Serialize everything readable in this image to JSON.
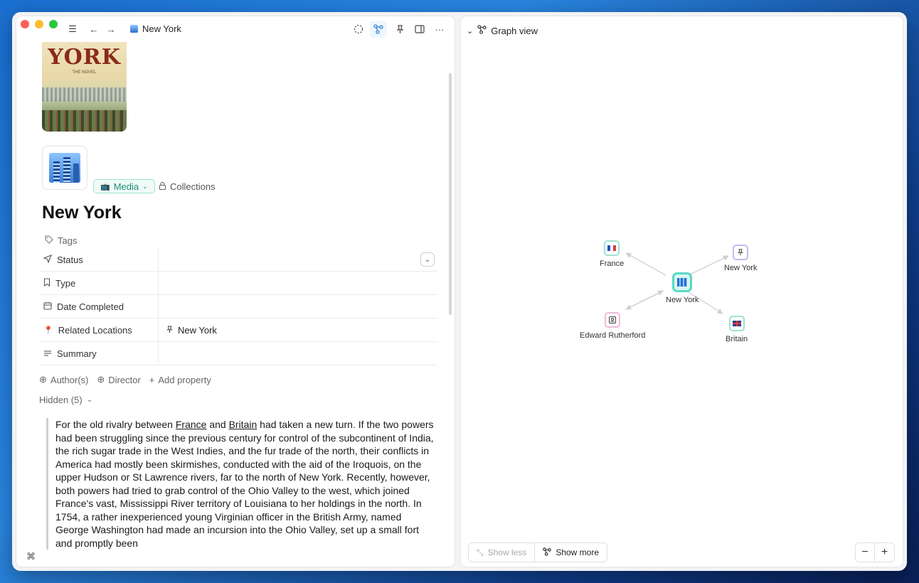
{
  "toolbar": {
    "breadcrumb": "New York"
  },
  "page": {
    "cover_title": "YORK",
    "cover_subtitle": "THE NOVEL",
    "media_label": "Media",
    "collections_label": "Collections",
    "title": "New York",
    "tags_label": "Tags"
  },
  "properties": [
    {
      "label": "Status",
      "value": ""
    },
    {
      "label": "Type",
      "value": ""
    },
    {
      "label": "Date Completed",
      "value": ""
    },
    {
      "label": "Related Locations",
      "value": "New York"
    },
    {
      "label": "Summary",
      "value": ""
    }
  ],
  "add_props": {
    "authors": "Author(s)",
    "director": "Director",
    "add": "Add property"
  },
  "hidden_label": "Hidden (5)",
  "quote": {
    "p1": "For the old rivalry between ",
    "link1": "France",
    "p2": " and ",
    "link2": "Britain",
    "p3": " had taken a new turn. If the two powers had been struggling since the previous century for control of the subcontinent of India, the rich sugar trade in the West Indies, and the fur trade of the north, their conflicts in America had mostly been skirmishes, conducted with the aid of the Iroquois, on the upper Hudson or St Lawrence rivers, far to the north of New York. Recently, however, both powers had tried to grab control of the Ohio Valley to the west, which joined France's vast, Mississippi River territory of Louisiana to her holdings in the north. In 1754, a rather inexperienced young Virginian officer in the British Army, named George Washington had made an incursion into the Ohio Valley, set up a small fort and promptly been"
  },
  "graph": {
    "title": "Graph view",
    "center": "New York",
    "nodes": {
      "france": "France",
      "newyork_loc": "New York",
      "rutherford": "Edward Rutherford",
      "britain": "Britain"
    },
    "show_less": "Show less",
    "show_more": "Show more",
    "zoom_out": "−",
    "zoom_in": "+"
  },
  "colors": {
    "accent_teal": "#59d9c4",
    "node_purple": "#c7b8f0",
    "node_pink": "#f0b8d8"
  }
}
